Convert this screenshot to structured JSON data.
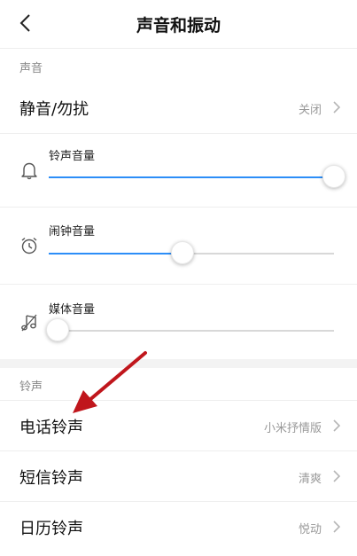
{
  "header": {
    "title": "声音和振动"
  },
  "sections": {
    "sound_label": "声音",
    "ringtone_label": "铃声"
  },
  "dnd": {
    "label": "静音/勿扰",
    "value": "关闭"
  },
  "volumes": [
    {
      "label": "铃声音量",
      "icon": "bell-icon",
      "level": 1.0
    },
    {
      "label": "闹钟音量",
      "icon": "alarm-clock-icon",
      "level": 0.47
    },
    {
      "label": "媒体音量",
      "icon": "music-note-icon",
      "level": 0.03
    }
  ],
  "ringtones": [
    {
      "label": "电话铃声",
      "value": "小米抒情版"
    },
    {
      "label": "短信铃声",
      "value": "清爽"
    },
    {
      "label": "日历铃声",
      "value": "悦动"
    }
  ],
  "colors": {
    "accent": "#2c8ef8",
    "annotation_arrow": "#c0161c"
  }
}
